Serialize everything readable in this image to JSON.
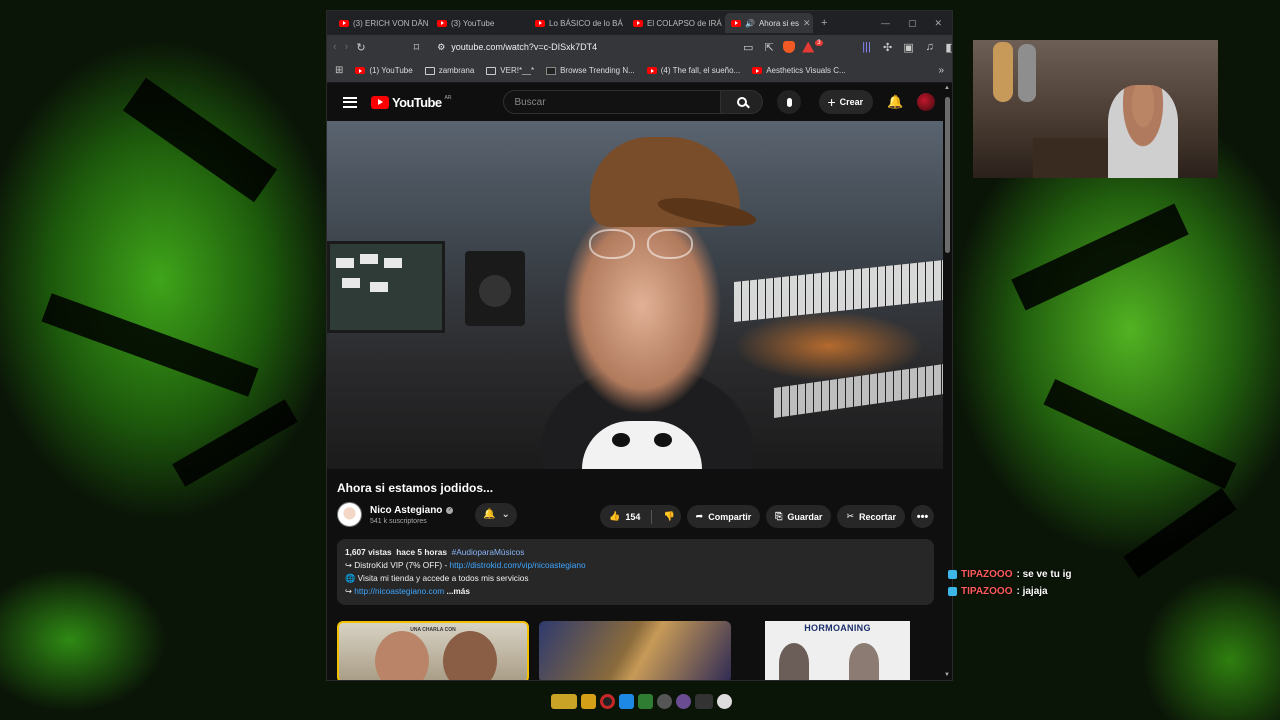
{
  "browser": {
    "tabs": [
      {
        "label": "(3) ERICH VON DÄN"
      },
      {
        "label": "(3) YouTube"
      },
      {
        "label": "Lo BÁSICO de lo BÁ"
      },
      {
        "label": "El COLAPSO de IRÁ"
      },
      {
        "label": "Ahora si es",
        "active": true
      }
    ],
    "url": "youtube.com/watch?v=c-DISxk7DT4",
    "shield_badge": "3",
    "bookmarks": [
      {
        "label": "(1) YouTube",
        "icon": "youtube-icon"
      },
      {
        "label": "zambrana",
        "icon": "folder-icon"
      },
      {
        "label": "VER!*__*",
        "icon": "folder-icon"
      },
      {
        "label": "Browse Trending N...",
        "icon": "site-icon"
      },
      {
        "label": "(4) The fall, el sueño...",
        "icon": "youtube-icon"
      },
      {
        "label": "Aesthetics Visuals C...",
        "icon": "youtube-icon"
      }
    ]
  },
  "youtube": {
    "logo_text": "YouTube",
    "country": "AR",
    "search_placeholder": "Buscar",
    "create_label": "Crear",
    "video_title": "Ahora si estamos jodidos...",
    "channel_name": "Nico Astegiano",
    "subscribers": "541 k suscriptores",
    "likes": "154",
    "share_label": "Compartir",
    "save_label": "Guardar",
    "clip_label": "Recortar",
    "description": {
      "views": "1,607 vistas",
      "time": "hace 5 horas",
      "hashtag": "#AudioparaMúsicos",
      "line1_prefix": "↪ DistroKid VIP (7% OFF) - ",
      "line1_link": "http://distrokid.com/vip/nicoastegiano",
      "line2": "🌐 Visita mi tienda y accede a todos mis servicios",
      "line3_prefix": "↪ ",
      "line3_link": "http://nicoastegiano.com",
      "more": "...más"
    },
    "related": [
      {
        "caption": "UNA CHARLA CON"
      },
      {
        "caption": ""
      },
      {
        "caption": "HORMOANING"
      }
    ]
  },
  "chat": [
    {
      "user": "TIPAZOOO",
      "text": ": se ve tu ig"
    },
    {
      "user": "TIPAZOOO",
      "text": ": jajaja"
    }
  ],
  "colors": {
    "yt_red": "#ff0000",
    "link_blue": "#3ea6ff",
    "chat_user": "#ff5a5a",
    "bg_green": "#3fa51a"
  }
}
